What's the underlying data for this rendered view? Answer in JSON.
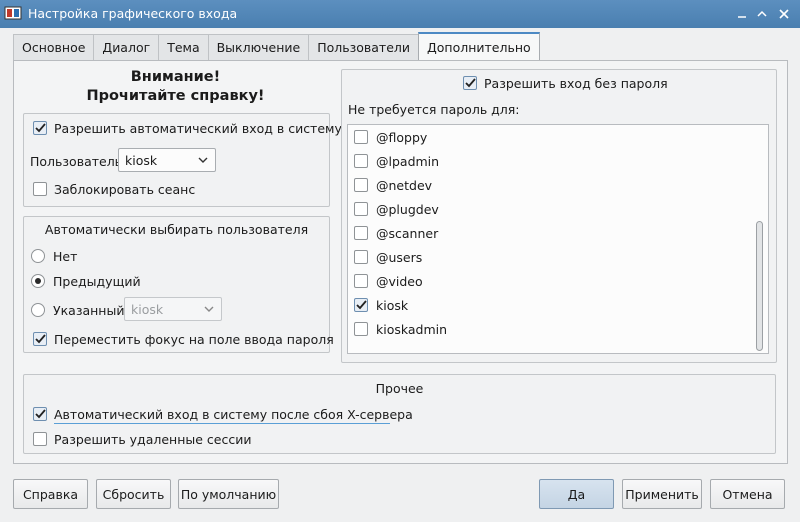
{
  "window": {
    "title": "Настройка графического входа"
  },
  "tabs": [
    {
      "label": "Основное"
    },
    {
      "label": "Диалог"
    },
    {
      "label": "Тема"
    },
    {
      "label": "Выключение"
    },
    {
      "label": "Пользователи"
    },
    {
      "label": "Дополнительно"
    }
  ],
  "active_tab": "Дополнительно",
  "warning": {
    "line1": "Внимание!",
    "line2": "Прочитайте справку!"
  },
  "autologin": {
    "enable_label": "Разрешить автоматический вход в систему",
    "enabled": true,
    "user_label": "Пользователь:",
    "user_value": "kiosk",
    "lock_label": "Заблокировать сеанс",
    "lock_checked": false
  },
  "autoselect": {
    "title": "Автоматически выбирать пользователя",
    "options": [
      {
        "label": "Нет",
        "checked": false
      },
      {
        "label": "Предыдущий",
        "checked": true
      },
      {
        "label": "Указанный:",
        "checked": false
      }
    ],
    "specified_value": "kiosk",
    "focus_label": "Переместить фокус на поле ввода пароля",
    "focus_checked": true
  },
  "nopassword": {
    "enable_label": "Разрешить вход без пароля",
    "enabled": true,
    "list_label": "Не требуется пароль для:",
    "items": [
      {
        "label": "@floppy",
        "checked": false
      },
      {
        "label": "@lpadmin",
        "checked": false
      },
      {
        "label": "@netdev",
        "checked": false
      },
      {
        "label": "@plugdev",
        "checked": false
      },
      {
        "label": "@scanner",
        "checked": false
      },
      {
        "label": "@users",
        "checked": false
      },
      {
        "label": "@video",
        "checked": false
      },
      {
        "label": "kiosk",
        "checked": true
      },
      {
        "label": "kioskadmin",
        "checked": false
      }
    ]
  },
  "misc": {
    "title": "Прочее",
    "crash_label": "Автоматический вход в систему после сбоя X-сервера",
    "crash_checked": true,
    "remote_label": "Разрешить удаленные сессии",
    "remote_checked": false
  },
  "buttons": {
    "help": "Справка",
    "reset": "Сбросить",
    "defaults": "По умолчанию",
    "ok": "Да",
    "apply": "Применить",
    "cancel": "Отмена"
  },
  "colors": {
    "titlebar": "#4a7fb0",
    "accent": "#4d8ac4"
  }
}
